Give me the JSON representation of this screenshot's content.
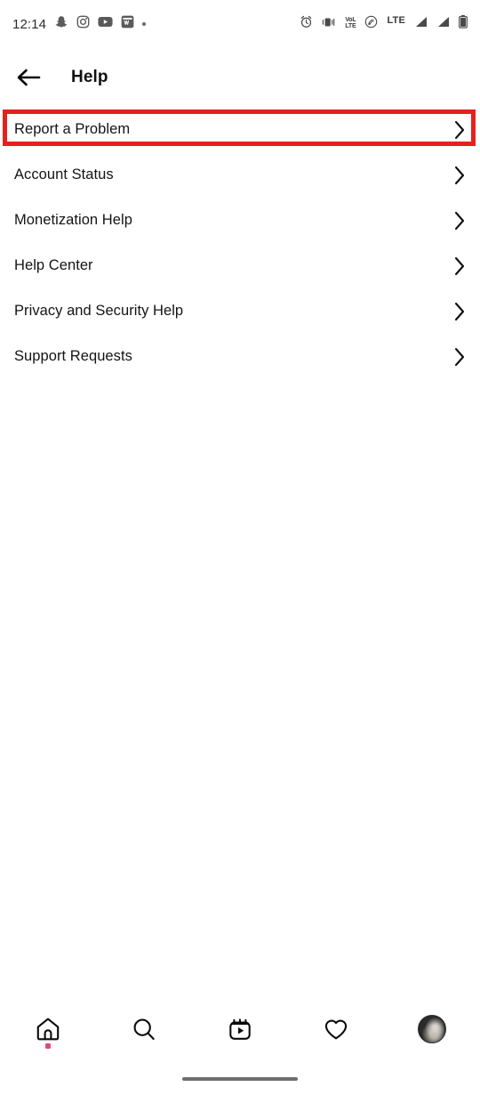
{
  "status_bar": {
    "time": "12:14",
    "left_icons": [
      {
        "name": "snapchat-icon",
        "label": "Snapchat"
      },
      {
        "name": "instagram-icon",
        "label": "Instagram"
      },
      {
        "name": "youtube-icon",
        "label": "YouTube"
      },
      {
        "name": "app-notification-icon",
        "label": "App notification"
      },
      {
        "name": "more-notifications-dot-icon",
        "label": "More"
      }
    ],
    "right_icons": [
      {
        "name": "alarm-clock-icon",
        "label": "Alarm"
      },
      {
        "name": "vibrate-icon",
        "label": "Vibrate"
      },
      {
        "name": "volte-icon",
        "label": "VoLTE",
        "line1": "VoL",
        "line2": "LTE"
      },
      {
        "name": "wifi-calling-icon",
        "label": "Wi-Fi calling"
      },
      {
        "name": "lte-label-icon",
        "label": "LTE",
        "text": "LTE"
      },
      {
        "name": "signal-bars-sim1-icon",
        "label": "Signal SIM 1"
      },
      {
        "name": "signal-bars-sim2-icon",
        "label": "Signal SIM 2"
      },
      {
        "name": "battery-icon",
        "label": "Battery"
      }
    ]
  },
  "header": {
    "back_label": "Back",
    "title": "Help"
  },
  "menu": {
    "items": [
      {
        "label": "Report a Problem",
        "highlighted": true
      },
      {
        "label": "Account Status",
        "highlighted": false
      },
      {
        "label": "Monetization Help",
        "highlighted": false
      },
      {
        "label": "Help Center",
        "highlighted": false
      },
      {
        "label": "Privacy and Security Help",
        "highlighted": false
      },
      {
        "label": "Support Requests",
        "highlighted": false
      }
    ]
  },
  "highlight": {
    "color": "#e8201d",
    "target": "Report a Problem"
  },
  "bottom_nav": {
    "items": [
      {
        "name": "nav-home",
        "label": "Home",
        "icon": "home-icon",
        "badge": true
      },
      {
        "name": "nav-search",
        "label": "Search",
        "icon": "search-icon",
        "badge": false
      },
      {
        "name": "nav-reels",
        "label": "Reels",
        "icon": "reels-icon",
        "badge": false
      },
      {
        "name": "nav-activity",
        "label": "Activity",
        "icon": "heart-icon",
        "badge": false
      },
      {
        "name": "nav-profile",
        "label": "Profile",
        "icon": "avatar-icon",
        "badge": false
      }
    ],
    "badge_color": "#e8457a"
  },
  "gesture_bar": {
    "label": "Home gesture bar"
  }
}
